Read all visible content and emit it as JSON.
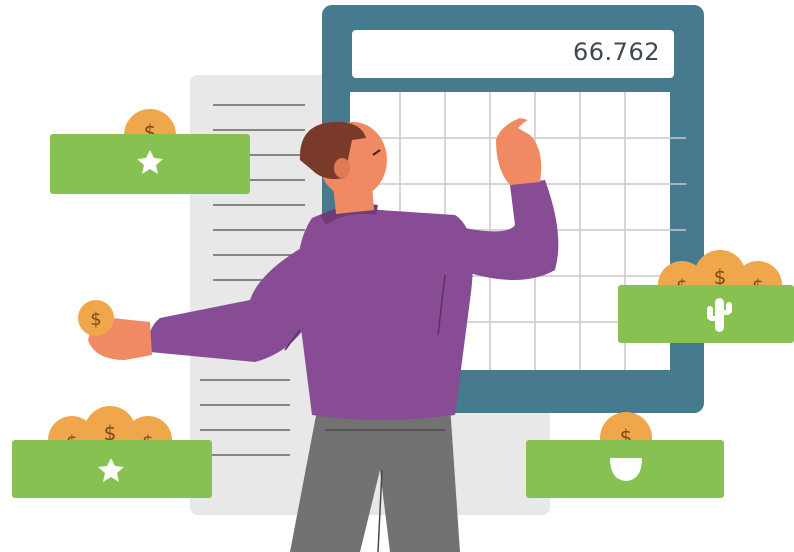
{
  "calculator": {
    "display_value": "66.762"
  },
  "coins": {
    "symbol": "$"
  },
  "colors": {
    "calculator_frame": "#457a8f",
    "screen": "#ffffff",
    "grid_lines": "#c9c9c9",
    "receipt": "#e8e8e8",
    "card_green": "#86c151",
    "coin": "#f0a64b",
    "shirt": "#874c93",
    "pants": "#727272",
    "skin": "#f08a62",
    "hair": "#7a3a2a"
  },
  "icons": [
    "star-icon",
    "star-icon",
    "cactus-icon",
    "smile-icon",
    "dollar-coin-icon"
  ]
}
